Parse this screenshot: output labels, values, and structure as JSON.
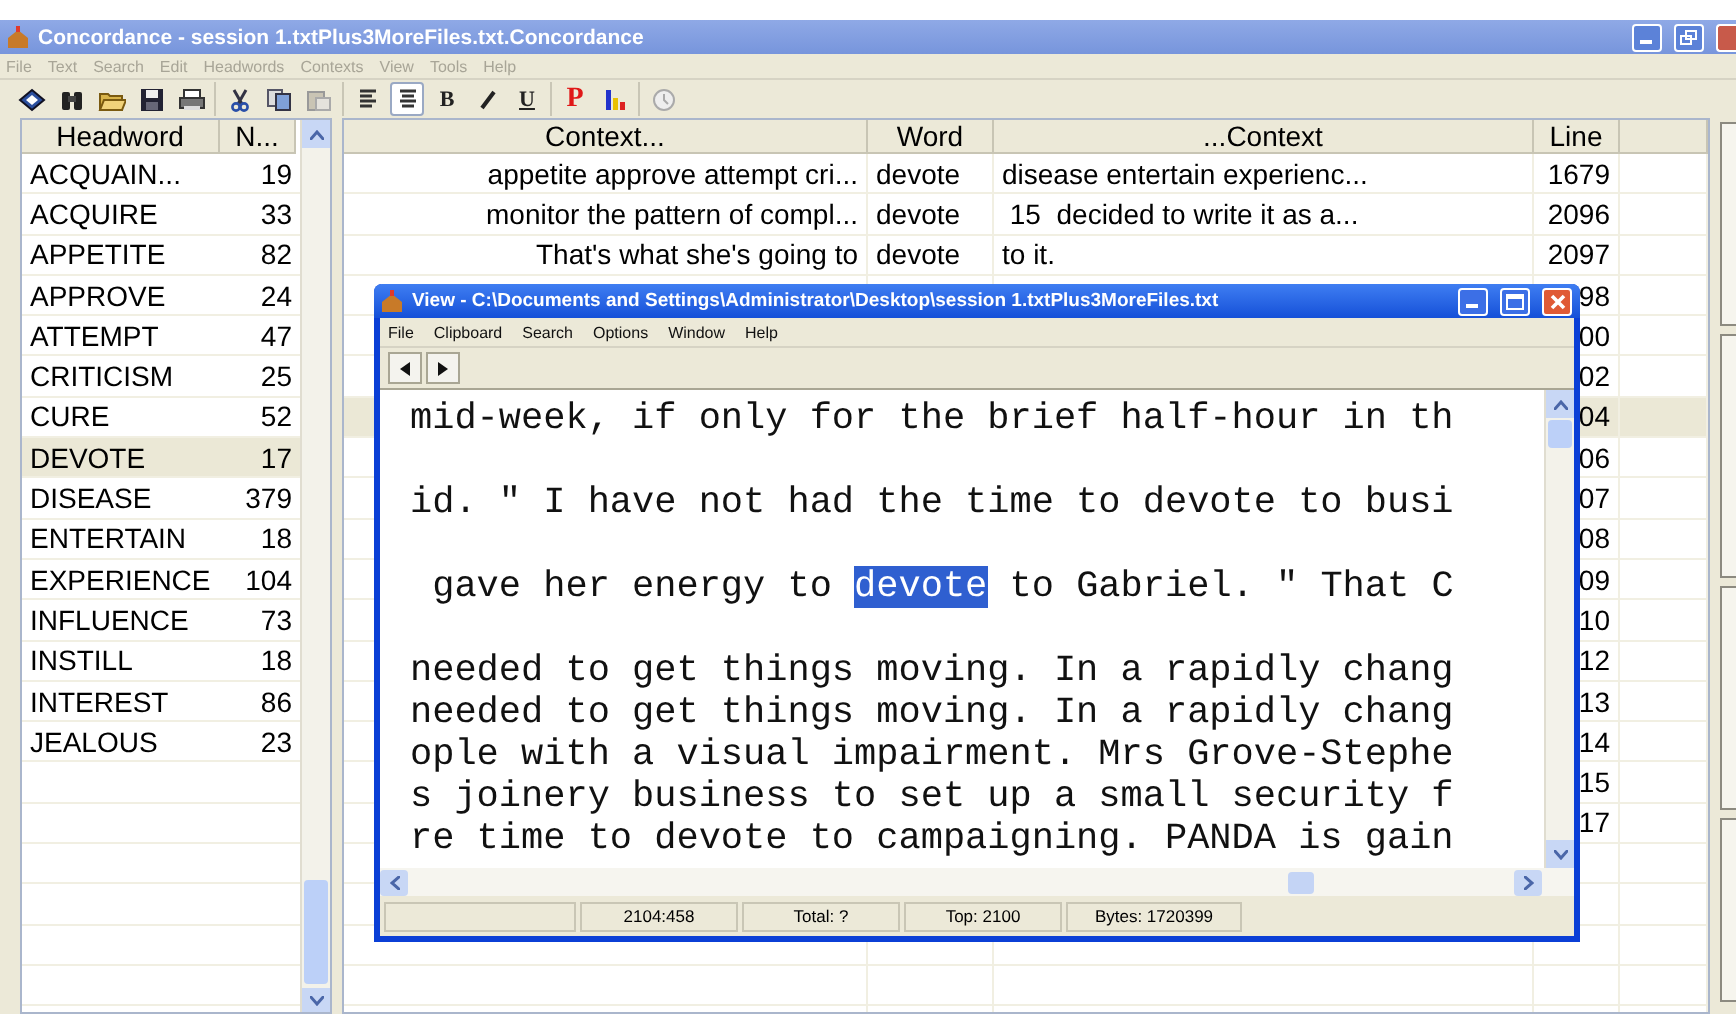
{
  "window": {
    "title": "Concordance - session 1.txtPlus3MoreFiles.txt.Concordance"
  },
  "menu": [
    "File",
    "Text",
    "Search",
    "Edit",
    "Headwords",
    "Contexts",
    "View",
    "Tools",
    "Help"
  ],
  "toolbar": {
    "groups": [
      {
        "items": [
          {
            "kind": "diamond",
            "pressed": false
          },
          {
            "kind": "binoculars",
            "pressed": false
          },
          {
            "kind": "folder",
            "pressed": false
          },
          {
            "kind": "save",
            "pressed": false
          },
          {
            "kind": "print",
            "pressed": false
          }
        ]
      },
      {
        "items": [
          {
            "kind": "cut",
            "pressed": false
          },
          {
            "kind": "copy",
            "pressed": false
          },
          {
            "kind": "paste",
            "pressed": false
          }
        ]
      },
      {
        "items": [
          {
            "kind": "align-left",
            "pressed": false
          },
          {
            "kind": "align-center",
            "pressed": true
          },
          {
            "kind": "text",
            "label": "B",
            "pressed": false
          },
          {
            "kind": "italic",
            "pressed": false
          },
          {
            "kind": "text",
            "label": "U",
            "pressed": false
          }
        ]
      },
      {
        "items": [
          {
            "kind": "red-text",
            "label": "P",
            "pressed": false
          },
          {
            "kind": "bars",
            "pressed": false
          }
        ]
      },
      {
        "items": [
          {
            "kind": "clock",
            "pressed": false
          }
        ]
      }
    ]
  },
  "headwords": {
    "columns": [
      "Headword",
      "N..."
    ],
    "rows": [
      {
        "word": "ACQUAIN...",
        "count": "19",
        "selected": false
      },
      {
        "word": "ACQUIRE",
        "count": "33",
        "selected": false
      },
      {
        "word": "APPETITE",
        "count": "82",
        "selected": false
      },
      {
        "word": "APPROVE",
        "count": "24",
        "selected": false
      },
      {
        "word": "ATTEMPT",
        "count": "47",
        "selected": false
      },
      {
        "word": "CRITICISM",
        "count": "25",
        "selected": false
      },
      {
        "word": "CURE",
        "count": "52",
        "selected": false
      },
      {
        "word": "DEVOTE",
        "count": "17",
        "selected": true
      },
      {
        "word": "DISEASE",
        "count": "379",
        "selected": false
      },
      {
        "word": "ENTERTAIN",
        "count": "18",
        "selected": false
      },
      {
        "word": "EXPERIENCE",
        "count": "104",
        "selected": false
      },
      {
        "word": "INFLUENCE",
        "count": "73",
        "selected": false
      },
      {
        "word": "INSTILL",
        "count": "18",
        "selected": false
      },
      {
        "word": "INTEREST",
        "count": "86",
        "selected": false
      },
      {
        "word": "JEALOUS",
        "count": "23",
        "selected": false
      }
    ]
  },
  "contexts": {
    "columns": [
      "Context...",
      "Word",
      "...Context",
      "Line"
    ],
    "rows": [
      {
        "left": "appetite approve attempt cri...",
        "word": "devote",
        "right": "disease entertain experienc...",
        "line": "1679",
        "selected": false
      },
      {
        "left": "monitor the pattern of compl...",
        "word": "devote",
        "right": " 15  decided to write it as a...",
        "line": "2096",
        "selected": false
      },
      {
        "left": "That's what she's going to",
        "word": "devote",
        "right": "to it.",
        "line": "2097",
        "selected": false
      },
      {
        "line": "98",
        "selected": false
      },
      {
        "line": "00",
        "selected": false
      },
      {
        "line": "02",
        "selected": false
      },
      {
        "line": "04",
        "selected": true
      },
      {
        "line": "06",
        "selected": false
      },
      {
        "line": "07",
        "selected": false
      },
      {
        "line": "08",
        "selected": false
      },
      {
        "line": "09",
        "selected": false
      },
      {
        "line": "10",
        "selected": false
      },
      {
        "line": "12",
        "selected": false
      },
      {
        "line": "13",
        "selected": false
      },
      {
        "line": "14",
        "selected": false
      },
      {
        "line": "15",
        "selected": false
      },
      {
        "line": "17",
        "selected": false
      }
    ]
  },
  "view_window": {
    "title": "View - C:\\Documents and Settings\\Administrator\\Desktop\\session 1.txtPlus3MoreFiles.txt",
    "menu": [
      "File",
      "Clipboard",
      "Search",
      "Options",
      "Window",
      "Help"
    ],
    "lines": [
      {
        "kind": "text",
        "parts": [
          {
            "text": "mid-week, if only for the brief half-hour in th",
            "selected": false
          }
        ]
      },
      {
        "kind": "blank"
      },
      {
        "kind": "text",
        "parts": [
          {
            "text": "id. \" I have not had the time to devote to busi",
            "selected": false
          }
        ]
      },
      {
        "kind": "blank"
      },
      {
        "kind": "text",
        "parts": [
          {
            "text": " gave her energy to ",
            "selected": false
          },
          {
            "text": "devote",
            "selected": true
          },
          {
            "text": " to Gabriel. \" That C",
            "selected": false
          }
        ]
      },
      {
        "kind": "blank"
      },
      {
        "kind": "text",
        "parts": [
          {
            "text": "needed to get things moving. In a rapidly chang",
            "selected": false
          }
        ]
      },
      {
        "kind": "text",
        "parts": [
          {
            "text": "needed to get things moving. In a rapidly chang",
            "selected": false
          }
        ]
      },
      {
        "kind": "text",
        "parts": [
          {
            "text": "ople with a visual impairment. Mrs Grove-Stephe",
            "selected": false
          }
        ]
      },
      {
        "kind": "text",
        "parts": [
          {
            "text": "s joinery business to set up a small security f",
            "selected": false
          }
        ]
      },
      {
        "kind": "text",
        "parts": [
          {
            "text": "re time to devote to campaigning. PANDA is gain",
            "selected": false
          }
        ]
      }
    ],
    "status_bar": [
      "2104:458",
      "Total: ?",
      "Top: 2100",
      "Bytes: 1720399"
    ]
  }
}
